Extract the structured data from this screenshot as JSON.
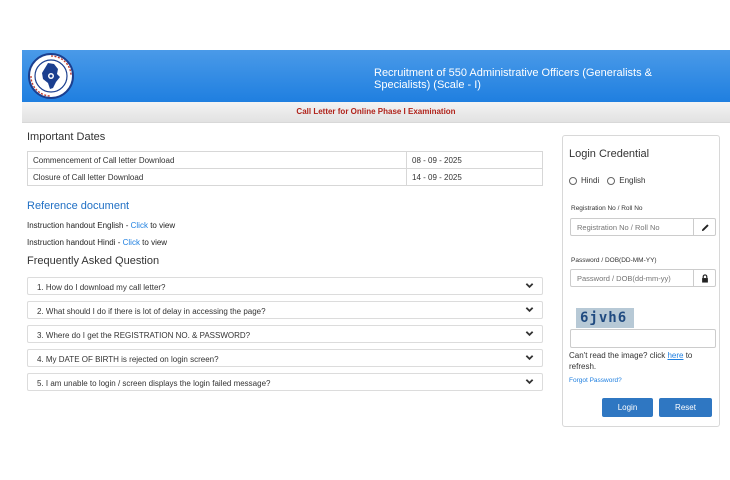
{
  "header": {
    "title": "Recruitment of 550 Administrative Officers (Generalists & Specialists) (Scale - I)",
    "subtitle": "Call Letter for Online Phase I Examination"
  },
  "important_dates": {
    "heading": "Important Dates",
    "rows": [
      {
        "label": "Commencement of Call letter Download",
        "date": "08 - 09 - 2025"
      },
      {
        "label": "Closure of Call letter Download",
        "date": "14 - 09 - 2025"
      }
    ]
  },
  "reference": {
    "heading": "Reference document",
    "items": [
      {
        "prefix": "Instruction handout English - ",
        "link": "Click",
        "suffix": " to view"
      },
      {
        "prefix": "Instruction handout Hindi - ",
        "link": "Click",
        "suffix": " to view"
      }
    ]
  },
  "faq": {
    "heading": "Frequently Asked Question",
    "items": [
      "1. How do I download my call letter?",
      "2. What should I do if there is lot of delay in accessing the page?",
      "3. Where do I get the REGISTRATION NO. & PASSWORD?",
      "4. My DATE OF BIRTH is rejected on login screen?",
      "5. I am unable to login / screen displays the login failed message?"
    ]
  },
  "login": {
    "title": "Login Credential",
    "lang_hindi": "Hindi",
    "lang_english": "English",
    "reg_label": "Registration No / Roll No",
    "reg_placeholder": "Registration No / Roll No",
    "pwd_label": "Password / DOB(DD-MM-YY)",
    "pwd_placeholder": "Password / DOB(dd-mm-yy)",
    "captcha_text": "6jvh6",
    "refresh_prefix": "Can't read the image? click ",
    "refresh_link": "here",
    "refresh_suffix": " to refresh.",
    "forgot": "Forgot Password?",
    "login_btn": "Login",
    "reset_btn": "Reset"
  },
  "colors": {
    "header_blue": "#1f7fe0",
    "subtitle_red": "#b0231b",
    "link_blue": "#1f7fe0",
    "button_blue": "#2f77c2"
  },
  "icons": [
    "organization-logo",
    "pencil-icon",
    "lock-icon",
    "chevron-down-icon"
  ]
}
